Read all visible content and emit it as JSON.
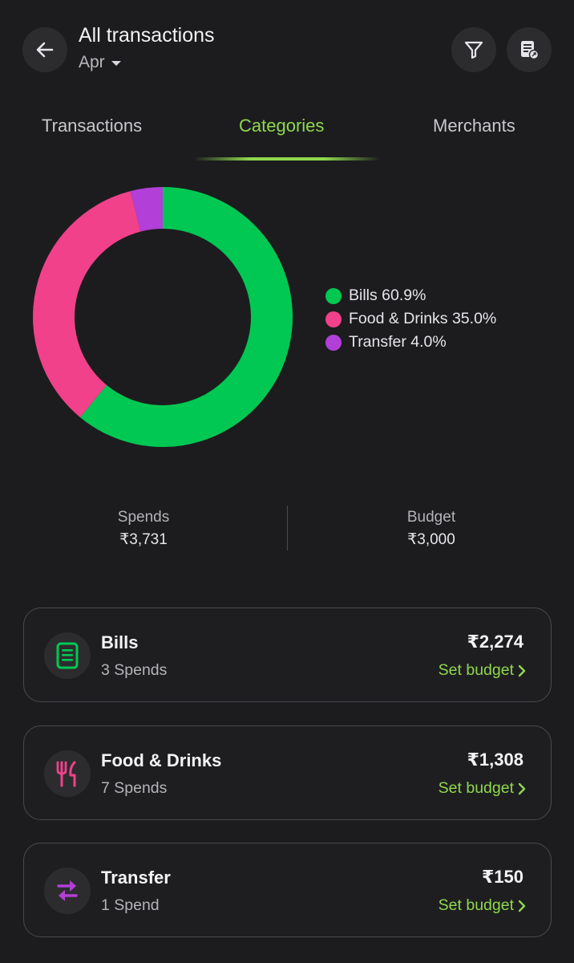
{
  "header": {
    "title": "All transactions",
    "month": "Apr",
    "icons": [
      "back-arrow-icon",
      "filter-icon",
      "report-export-icon"
    ]
  },
  "tabs": [
    {
      "label": "Transactions",
      "active": false
    },
    {
      "label": "Categories",
      "active": true
    },
    {
      "label": "Merchants",
      "active": false
    }
  ],
  "chart_data": {
    "type": "pie",
    "categories": [
      "Bills",
      "Food & Drinks",
      "Transfer"
    ],
    "values": [
      60.9,
      35.0,
      4.0
    ],
    "labels": [
      "Bills 60.9%",
      "Food & Drinks 35.0%",
      "Transfer 4.0%"
    ],
    "colors": [
      "#00c853",
      "#f0418a",
      "#b23fd8"
    ],
    "donut": true,
    "legend_placement": "right"
  },
  "summary": {
    "spends_label": "Spends",
    "spends_value": "₹3,731",
    "budget_label": "Budget",
    "budget_value": "₹3,000"
  },
  "categories": [
    {
      "name": "Bills",
      "count": "3 Spends",
      "amount": "₹2,274",
      "budget_label": "Set budget",
      "icon": "bill-icon",
      "color": "#00c853"
    },
    {
      "name": "Food & Drinks",
      "count": "7 Spends",
      "amount": "₹1,308",
      "budget_label": "Set budget",
      "icon": "fork-knife-icon",
      "color": "#f0418a"
    },
    {
      "name": "Transfer",
      "count": "1 Spend",
      "amount": "₹150",
      "budget_label": "Set budget",
      "icon": "transfer-arrows-icon",
      "color": "#b23fd8"
    }
  ],
  "colors": {
    "accent": "#8fd84e",
    "background": "#1c1c1e"
  }
}
